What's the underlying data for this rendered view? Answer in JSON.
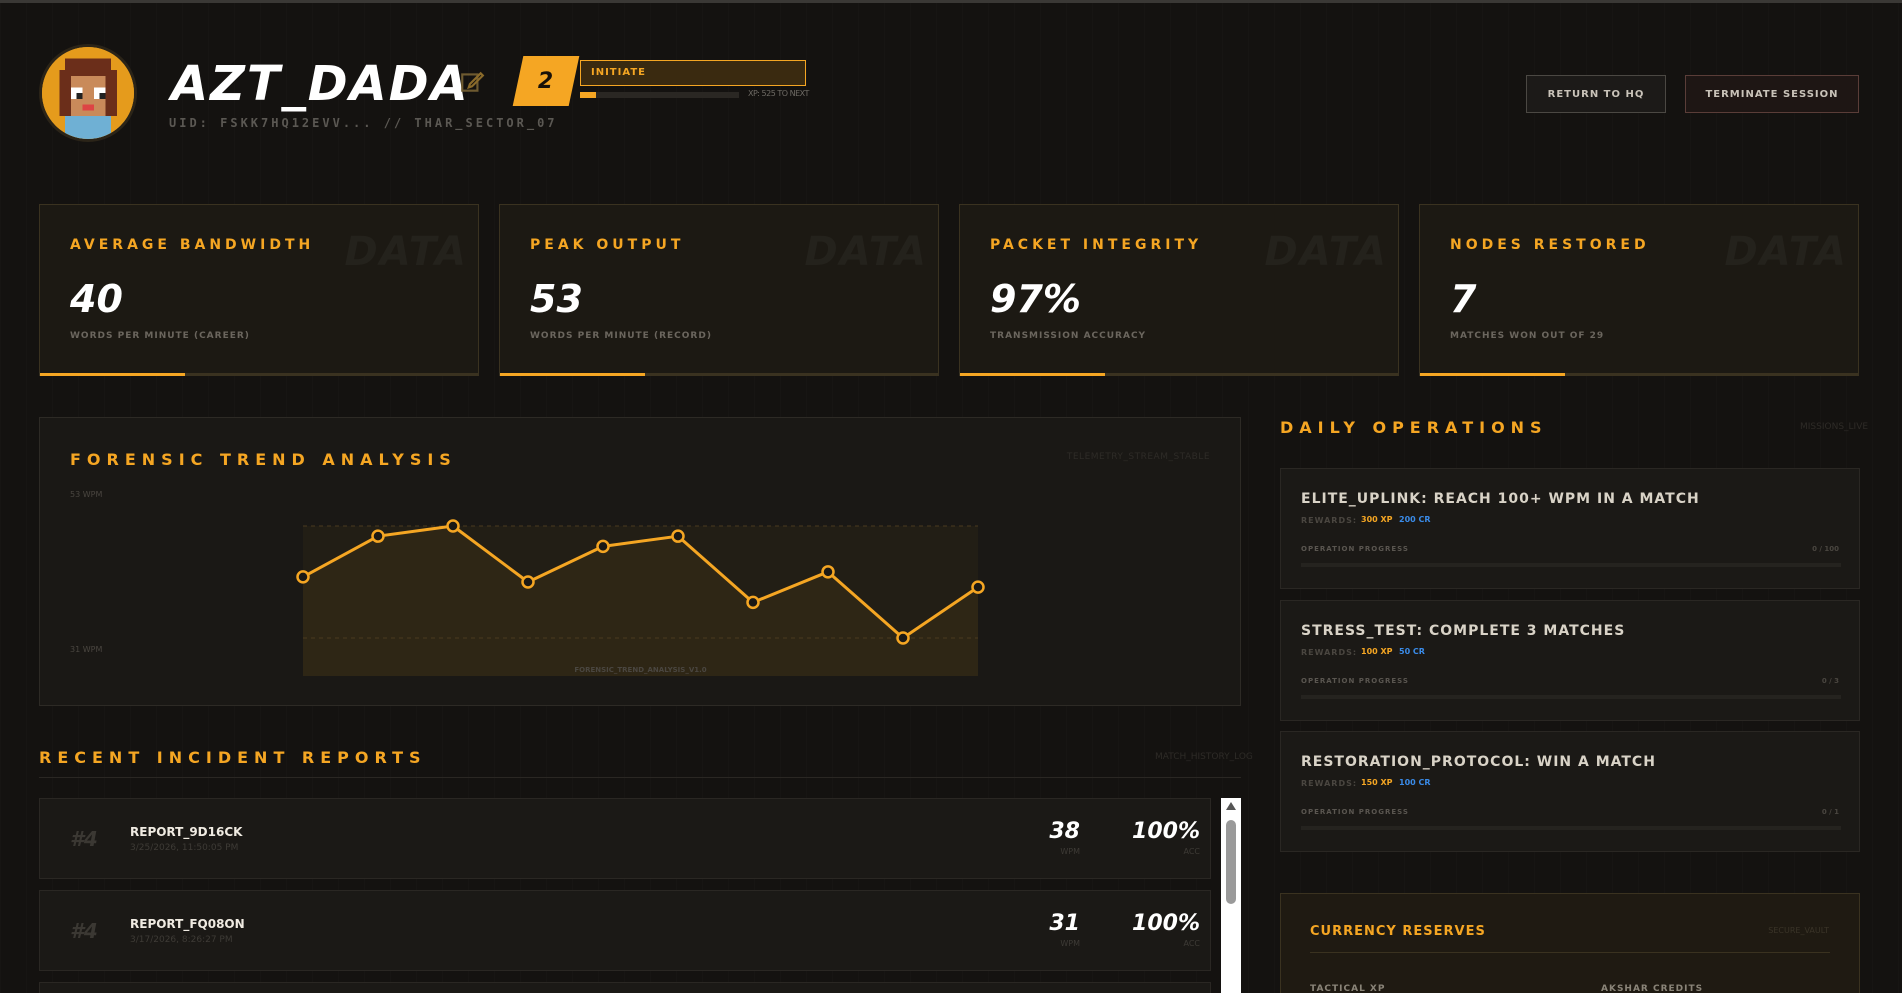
{
  "header": {
    "player_name": "AZT_DADA",
    "uid": "UID: FSKK7HQ12EVV... // THAR_SECTOR_07",
    "level": "2",
    "rank": "INITIATE",
    "xp_progress": 0.1,
    "xp_text": "XP: 525 TO NEXT",
    "return_label": "RETURN TO HQ",
    "terminate_label": "TERMINATE SESSION"
  },
  "stats": [
    {
      "title": "AVERAGE BANDWIDTH",
      "value": "40",
      "sub": "WORDS PER MINUTE (CAREER)",
      "watermark": "DATA",
      "progress": 0.33
    },
    {
      "title": "PEAK OUTPUT",
      "value": "53",
      "sub": "WORDS PER MINUTE (RECORD)",
      "watermark": "DATA",
      "progress": 0.33
    },
    {
      "title": "PACKET INTEGRITY",
      "value": "97%",
      "sub": "TRANSMISSION ACCURACY",
      "watermark": "DATA",
      "progress": 0.33
    },
    {
      "title": "NODES RESTORED",
      "value": "7",
      "sub": "MATCHES WON OUT OF 29",
      "watermark": "DATA",
      "progress": 0.33
    }
  ],
  "trend": {
    "title": "FORENSIC TREND ANALYSIS",
    "tag": "TELEMETRY_STREAM_STABLE",
    "top_label": "53 WPM",
    "bottom_label": "31 WPM",
    "caption": "FORENSIC_TREND_ANALYSIS_V1.0"
  },
  "chart_data": {
    "type": "line",
    "title": "FORENSIC TREND ANALYSIS",
    "ylim": [
      31,
      53
    ],
    "x": [
      1,
      2,
      3,
      4,
      5,
      6,
      7,
      8,
      9,
      10
    ],
    "values": [
      43,
      51,
      53,
      42,
      49,
      51,
      38,
      44,
      31,
      41
    ],
    "grid": true,
    "color": "#f5a623"
  },
  "incidents": {
    "title": "RECENT INCIDENT REPORTS",
    "tag": "MATCH_HISTORY_LOG",
    "rows": [
      {
        "rank": "#4",
        "id": "REPORT_9D16CK",
        "date": "3/25/2026, 11:50:05 PM",
        "wpm": "38",
        "wpm_label": "WPM",
        "acc": "100%",
        "acc_label": "ACC"
      },
      {
        "rank": "#4",
        "id": "REPORT_FQ08ON",
        "date": "3/17/2026, 8:26:27 PM",
        "wpm": "31",
        "wpm_label": "WPM",
        "acc": "100%",
        "acc_label": "ACC"
      }
    ]
  },
  "operations": {
    "title": "DAILY OPERATIONS",
    "tag": "MISSIONS_LIVE",
    "items": [
      {
        "name": "ELITE_UPLINK: REACH 100+ WPM IN A MATCH",
        "rewards_label": "REWARDS:",
        "xp": "300 XP",
        "cr": "200 CR",
        "progress_label": "OPERATION PROGRESS",
        "progress_value": "0 / 100"
      },
      {
        "name": "STRESS_TEST: COMPLETE 3 MATCHES",
        "rewards_label": "REWARDS:",
        "xp": "100 XP",
        "cr": "50 CR",
        "progress_label": "OPERATION PROGRESS",
        "progress_value": "0 / 3"
      },
      {
        "name": "RESTORATION_PROTOCOL: WIN A MATCH",
        "rewards_label": "REWARDS:",
        "xp": "150 XP",
        "cr": "100 CR",
        "progress_label": "OPERATION PROGRESS",
        "progress_value": "0 / 1"
      }
    ]
  },
  "currency": {
    "title": "CURRENCY RESERVES",
    "tag": "SECURE_VAULT",
    "label_xp": "TACTICAL XP",
    "label_credits": "AKSHAR CREDITS"
  },
  "colors": {
    "accent": "#f5a623",
    "credit_blue": "#3a8be8",
    "background": "#141210"
  }
}
